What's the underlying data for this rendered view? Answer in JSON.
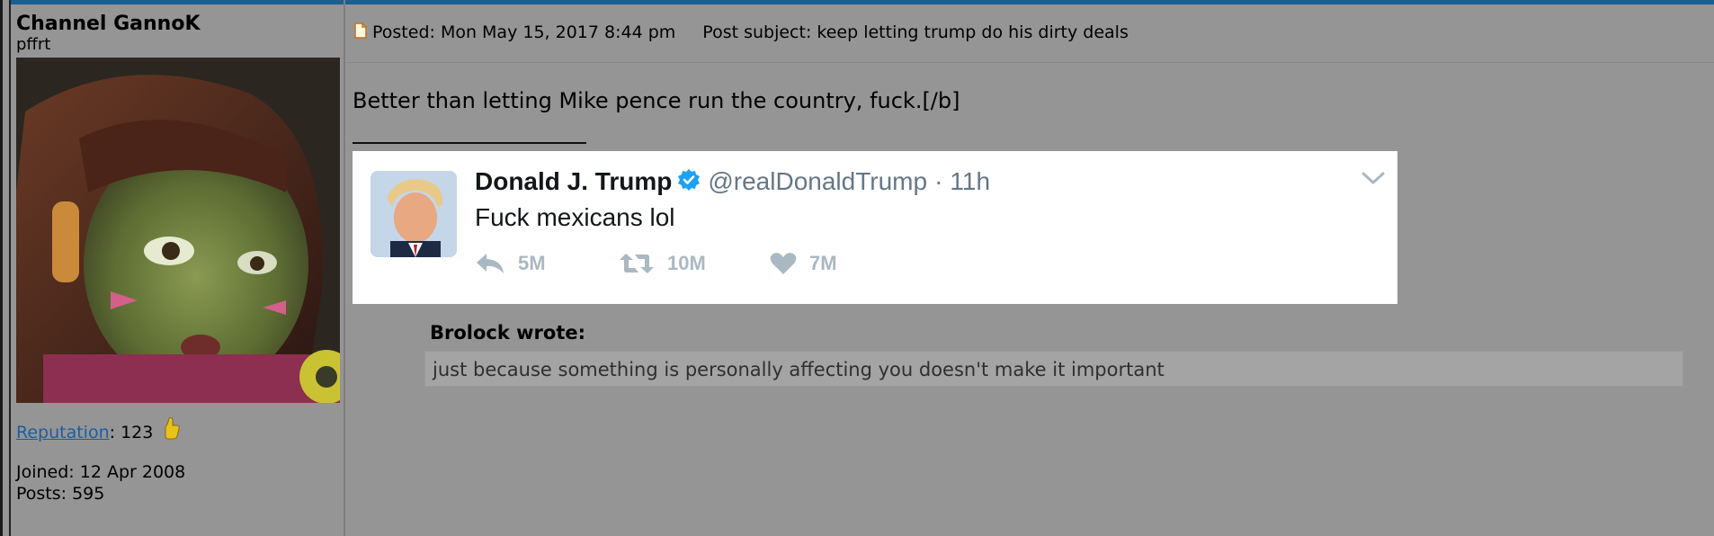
{
  "profile": {
    "username": "Channel GannoK",
    "rank": "pffrt",
    "reputation_label": "Reputation",
    "reputation_value": ": 123",
    "joined": "Joined: 12 Apr 2008",
    "posts": "Posts: 595"
  },
  "post": {
    "posted": "Posted: Mon May 15, 2017 8:44 pm",
    "subject": "Post subject: keep letting trump do his dirty deals",
    "body": "Better than letting Mike pence run the country, fuck.[/b]"
  },
  "tweet": {
    "name": "Donald J. Trump",
    "handle": "@realDonaldTrump",
    "separator": "·",
    "time": "11h",
    "text": "Fuck mexicans lol",
    "replies": "5M",
    "retweets": "10M",
    "likes": "7M"
  },
  "quote": {
    "author": "Brolock wrote:",
    "text": "just because something is personally affecting you doesn't make it important"
  },
  "colors": {
    "background": "#959595",
    "topbar": "#1a5f8f",
    "link": "#1a5f9f",
    "verified": "#1da1f2",
    "tweet_muted": "#aab8c2"
  }
}
